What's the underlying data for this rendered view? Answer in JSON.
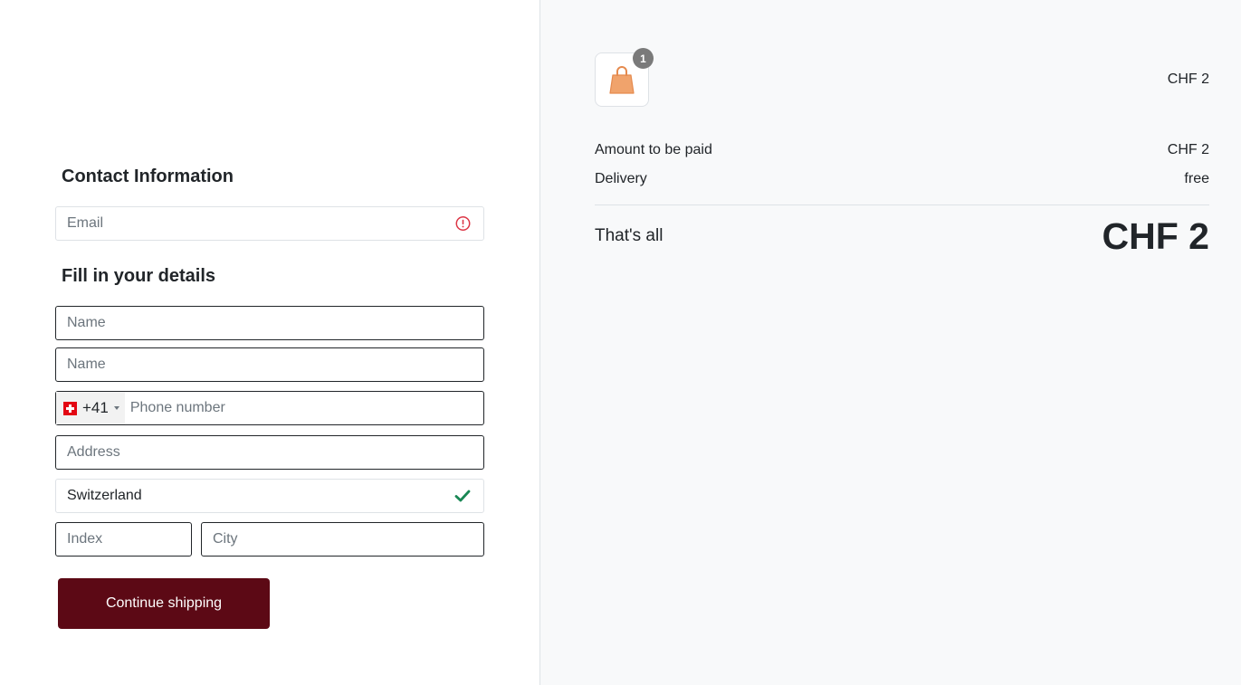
{
  "contact": {
    "title": "Contact Information",
    "email_placeholder": "Email",
    "email_status": "error"
  },
  "details": {
    "title": "Fill in your details",
    "first_name_placeholder": "Name",
    "last_name_placeholder": "Name",
    "phone": {
      "country_flag": "switzerland-flag",
      "prefix": "+41",
      "placeholder": "Phone number"
    },
    "address_placeholder": "Address",
    "country_value": "Switzerland",
    "country_status": "valid",
    "index_placeholder": "Index",
    "city_placeholder": "City"
  },
  "actions": {
    "continue_label": "Continue shipping"
  },
  "summary": {
    "item": {
      "icon": "shopping-bag-icon",
      "quantity": "1",
      "price": "CHF 2"
    },
    "amount_label": "Amount to be paid",
    "amount_value": "CHF 2",
    "delivery_label": "Delivery",
    "delivery_value": "free",
    "total_label": "That's all",
    "total_value": "CHF 2"
  },
  "colors": {
    "primary_button": "#5c0915",
    "error": "#dc3545",
    "success": "#198754",
    "bag": "#f0a36c"
  }
}
